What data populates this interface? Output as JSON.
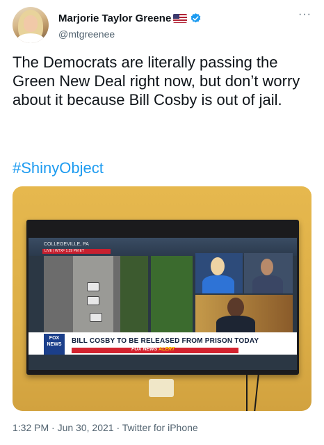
{
  "author": {
    "name": "Marjorie Taylor Greene",
    "handle": "@mtgreenee",
    "badges": [
      "us-flag-icon",
      "verified-icon"
    ]
  },
  "menu": {
    "more_label": "···"
  },
  "tweet": {
    "text": "The Democrats are literally passing the Green New Deal right now, but don’t worry about it because Bill Cosby is out of jail.",
    "hashtag": "#ShinyObject"
  },
  "photo": {
    "location": "COLLEGEVILLE, PA",
    "live_bar": "LIVE  |  WTXF   1:29 PM ET",
    "logo_top": "FOX",
    "logo_bottom": "NEWS",
    "headline": "BILL COSBY TO BE RELEASED FROM PRISON TODAY",
    "alert_network": "FOX NEWS",
    "alert_word": "ALERT"
  },
  "footer": {
    "time": "1:32 PM",
    "date": "Jun 30, 2021",
    "source": "Twitter for iPhone",
    "separator": "·"
  },
  "colors": {
    "link": "#1d9bf0",
    "secondary_text": "#536471",
    "verified": "#1d9bf0"
  }
}
